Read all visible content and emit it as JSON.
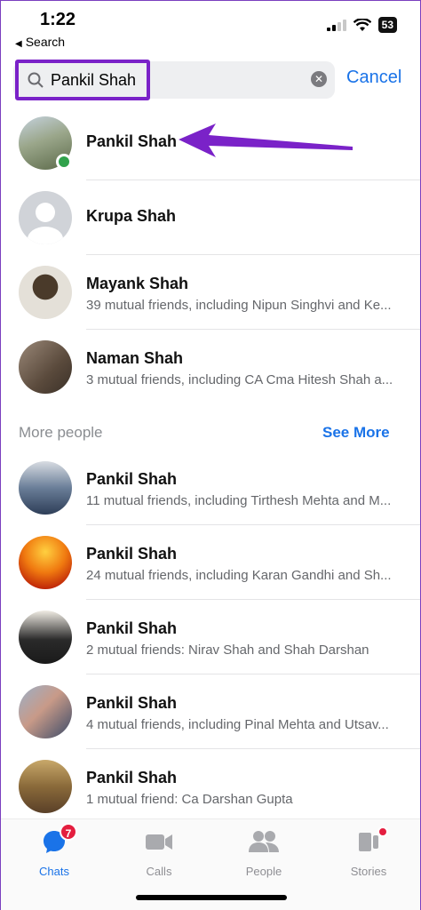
{
  "status_bar": {
    "time": "1:22",
    "back_label": "Search",
    "battery": "53"
  },
  "search": {
    "value": "Pankil Shah",
    "cancel_label": "Cancel"
  },
  "results": [
    {
      "name": "Pankil Shah",
      "subtitle": "",
      "online": true,
      "avatar_color": "#7c8a6a"
    },
    {
      "name": "Krupa Shah",
      "subtitle": "",
      "online": false,
      "avatar_color": "#d0d3d8"
    },
    {
      "name": "Mayank Shah",
      "subtitle": "39 mutual friends, including Nipun Singhvi and Ke...",
      "online": false,
      "avatar_color": "#c9b49a"
    },
    {
      "name": "Naman Shah",
      "subtitle": "3 mutual friends, including CA Cma Hitesh Shah a...",
      "online": false,
      "avatar_color": "#6b5a4a"
    }
  ],
  "more_people": {
    "title": "More people",
    "see_more_label": "See More",
    "items": [
      {
        "name": "Pankil Shah",
        "subtitle": "11 mutual friends, including Tirthesh Mehta and M...",
        "avatar_color": "#5a7aa0"
      },
      {
        "name": "Pankil Shah",
        "subtitle": "24 mutual friends, including Karan Gandhi and Sh...",
        "avatar_color": "#e86a10"
      },
      {
        "name": "Pankil Shah",
        "subtitle": "2 mutual friends: Nirav Shah and Shah Darshan",
        "avatar_color": "#3c3c3c"
      },
      {
        "name": "Pankil Shah",
        "subtitle": "4 mutual friends, including Pinal Mehta and Utsav...",
        "avatar_color": "#5b6e88"
      },
      {
        "name": "Pankil Shah",
        "subtitle": "1 mutual friend: Ca Darshan Gupta",
        "avatar_color": "#a88a5a"
      }
    ]
  },
  "tabs": [
    {
      "label": "Chats",
      "icon": "chat-bubble-icon",
      "badge": "7",
      "active": true
    },
    {
      "label": "Calls",
      "icon": "video-camera-icon",
      "active": false
    },
    {
      "label": "People",
      "icon": "people-icon",
      "active": false
    },
    {
      "label": "Stories",
      "icon": "stories-icon",
      "dot": true,
      "active": false
    }
  ],
  "colors": {
    "accent": "#1a73e8",
    "highlight": "#7a22c8",
    "online": "#31a24c",
    "badge": "#e41e3f"
  }
}
